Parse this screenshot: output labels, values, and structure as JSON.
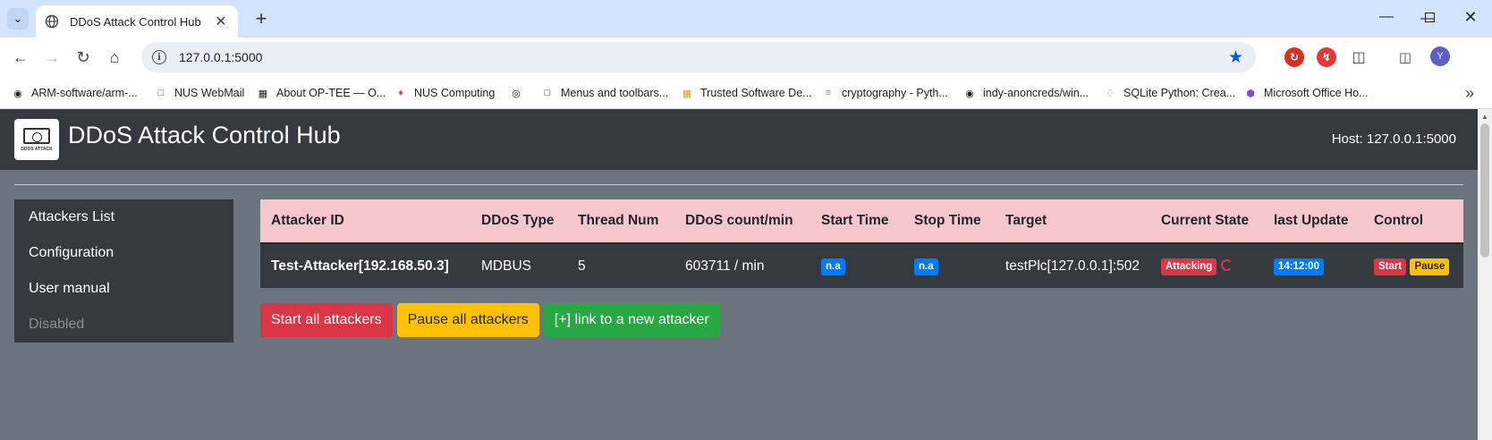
{
  "browser": {
    "tab_title": "DDoS Attack Control Hub",
    "url": "127.0.0.1:5000",
    "profile_initial": "Y",
    "bookmarks": [
      {
        "label": "ARM-software/arm-...",
        "icon": "github-icon"
      },
      {
        "label": "NUS WebMail",
        "icon": "nus-icon"
      },
      {
        "label": "About OP-TEE — O...",
        "icon": "doc-icon"
      },
      {
        "label": "NUS Computing",
        "icon": "nus-crest-icon"
      },
      {
        "label": "",
        "icon": "globe-icon"
      },
      {
        "label": "Menus and toolbars...",
        "icon": "square-icon"
      },
      {
        "label": "Trusted Software De...",
        "icon": "grid-icon"
      },
      {
        "label": "cryptography - Pyth...",
        "icon": "stack-icon"
      },
      {
        "label": "indy-anoncreds/win...",
        "icon": "github-icon"
      },
      {
        "label": "SQLite Python: Crea...",
        "icon": "sqlite-icon"
      },
      {
        "label": "Microsoft Office Ho...",
        "icon": "office-icon"
      }
    ]
  },
  "app": {
    "title": "DDoS Attack Control Hub",
    "host": "Host: 127.0.0.1:5000",
    "logo_caption": "DDOS ATTACK"
  },
  "sidebar": {
    "items": [
      {
        "label": "Attackers List"
      },
      {
        "label": "Configuration"
      },
      {
        "label": "User manual"
      },
      {
        "label": "Disabled"
      }
    ]
  },
  "table": {
    "headers": [
      "Attacker ID",
      "DDoS Type",
      "Thread Num",
      "DDoS count/min",
      "Start Time",
      "Stop Time",
      "Target",
      "Current State",
      "last Update",
      "Control"
    ],
    "rows": [
      {
        "attacker_id": "Test-Attacker[192.168.50.3]",
        "ddos_type": "MDBUS",
        "thread_num": "5",
        "count": "603711 / min",
        "start_time": "n.a",
        "stop_time": "n.a",
        "target": "testPlc[127.0.0.1]:502",
        "state": "Attacking",
        "last_update": "14:12:00",
        "start_label": "Start",
        "pause_label": "Pause"
      }
    ]
  },
  "actions": {
    "start_all": "Start all attackers",
    "pause_all": "Pause all attackers",
    "link_new": "[+] link to a new attacker"
  },
  "colors": {
    "header_bg": "#343a40",
    "page_bg": "#6c757d",
    "table_head_bg": "#f5c6cb",
    "danger": "#dc3545",
    "warning": "#ffc107",
    "success": "#28a745",
    "info_badge": "#007bff"
  }
}
